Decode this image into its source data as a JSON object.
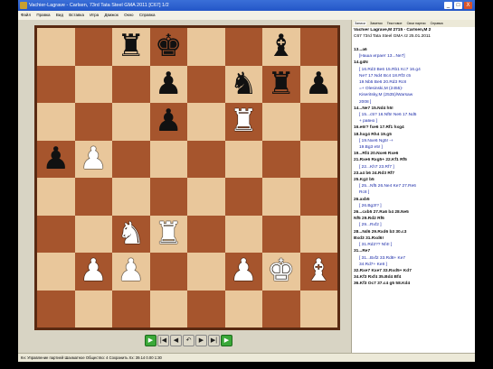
{
  "window": {
    "title": "Vachier-Lagrave - Carlsen, 73rd Tata Steel GMA 2011 [C67] 1/2",
    "buttons": [
      "_",
      "□",
      "X"
    ]
  },
  "menu": [
    "Файл",
    "Правка",
    "Вид",
    "Вставка",
    "Игра",
    "Движок",
    "Окно",
    "Справка"
  ],
  "tabs": [
    "Записи",
    "Заметки",
    "Текстовое",
    "Свои партии",
    "Справка"
  ],
  "header": {
    "players": "Vachier Lagrave,M 2715 - Carlsen,M 2",
    "event": "C67 73rd Tata Steel GMA r2 25.01.2011"
  },
  "moves": [
    {
      "t": "13...a6",
      "k": "mv"
    },
    {
      "t": "[Наша играет 13...Ne7]",
      "k": "vr"
    },
    {
      "t": "14.g4N",
      "k": "mv"
    },
    {
      "t": "[ 16.Rd3 Be6 15.Rb1 Kc7 16.g4",
      "k": "vr"
    },
    {
      "t": "Ne7 17.Nd4 Bc4 18.Rf3 c5",
      "k": "vr"
    },
    {
      "t": "19.Nb5 Be6 20.Rd3 Rc8",
      "k": "vr"
    },
    {
      "t": "=+ Olesinski,M (2455)-",
      "k": "vr"
    },
    {
      "t": "Kiseritsky,M (2535)/Warsaw",
      "k": "vr"
    },
    {
      "t": "2008 ]",
      "k": "vr"
    },
    {
      "t": "14...Ne7 15.Nd4 h5!",
      "k": "mv"
    },
    {
      "t": "[ 15...c5? 16.Nf5! Ne6 17.Nd5",
      "k": "vr"
    },
    {
      "t": "+ равно ]",
      "k": "vr"
    },
    {
      "t": "16.e6!? fxe6 17.Rf1 hxg4",
      "k": "mv"
    },
    {
      "t": "18.hxg4 Rh4 19.g5",
      "k": "mv"
    },
    {
      "t": "[ 19.Nxe6 Ng5! -+",
      "k": "vr"
    },
    {
      "t": "19.Bg3 e5! ]",
      "k": "vr"
    },
    {
      "t": "19...Rf4 20.Nxe6 Rxe6",
      "k": "mv"
    },
    {
      "t": "21.Rxe6 Rxg5+ 22.Kf1 Rf5",
      "k": "mv"
    },
    {
      "t": "[ 22...Kh7 23.Rf7 ]",
      "k": "vr"
    },
    {
      "t": "23.a4 b6 24.Rd3 Rf7",
      "k": "mv"
    },
    {
      "t": "25.Kg2 b5",
      "k": "mv"
    },
    {
      "t": "[ 25...Nf5 26.Ne4 Ke7 27.Re6",
      "k": "vr"
    },
    {
      "t": "Rc8 ]",
      "k": "vr"
    },
    {
      "t": "26.axb5",
      "k": "mv"
    },
    {
      "t": "[ 26.Bg3!? ]",
      "k": "vr"
    },
    {
      "t": "26...cxb5 27.Ra6 b4 28.Ne5",
      "k": "mv"
    },
    {
      "t": "Nf5 29.Rd2 Rf6",
      "k": "mv"
    },
    {
      "t": "[ 29...Rxf2 ]",
      "k": "vr"
    },
    {
      "t": "28...Nd6 29.Rxd6 b3 30.c3",
      "k": "mv"
    },
    {
      "t": "Bxd3 31.Rxd6!",
      "k": "mv"
    },
    {
      "t": "[ 31.Rd2?? Nf4! ]",
      "k": "vr"
    },
    {
      "t": "31...Re7",
      "k": "mv"
    },
    {
      "t": "[ 31...Bxf2 33.Rd8+ Ke7",
      "k": "vr"
    },
    {
      "t": "34.Rd7+ Ke8 ]",
      "k": "vr"
    },
    {
      "t": "32.Rxe7 Kxe7 33.Rxd5+ Kd7",
      "k": "mv"
    },
    {
      "t": "34.Kf3 Rxf4 35.Bd4 Bf4",
      "k": "mv"
    },
    {
      "t": "36.Kf3 Oc7 37.c4 g5 58.Kd4",
      "k": "mv"
    }
  ],
  "board": {
    "a8": null,
    "c8": "bR",
    "d8": "bK",
    "g8": "bB",
    "d7": "bP",
    "f7": "bN",
    "g7": "bR",
    "h7": "bP",
    "d6": "bP",
    "f6": "wR",
    "b5": "wP",
    "a5": "bP",
    "c3": "wN",
    "d3": "wR",
    "b2": "wP",
    "c2": "wP",
    "f2": "wP",
    "g2": "wK",
    "h2": "wB"
  },
  "nav_buttons": [
    "play-icon",
    "first-icon",
    "prev-icon",
    "undo-icon",
    "next-icon",
    "last-icon",
    "play-end-icon"
  ],
  "status": "Кн: Управление партией Шахматное Общество: 4 Сохранить     Хх: 39.14 0.00     1:30"
}
